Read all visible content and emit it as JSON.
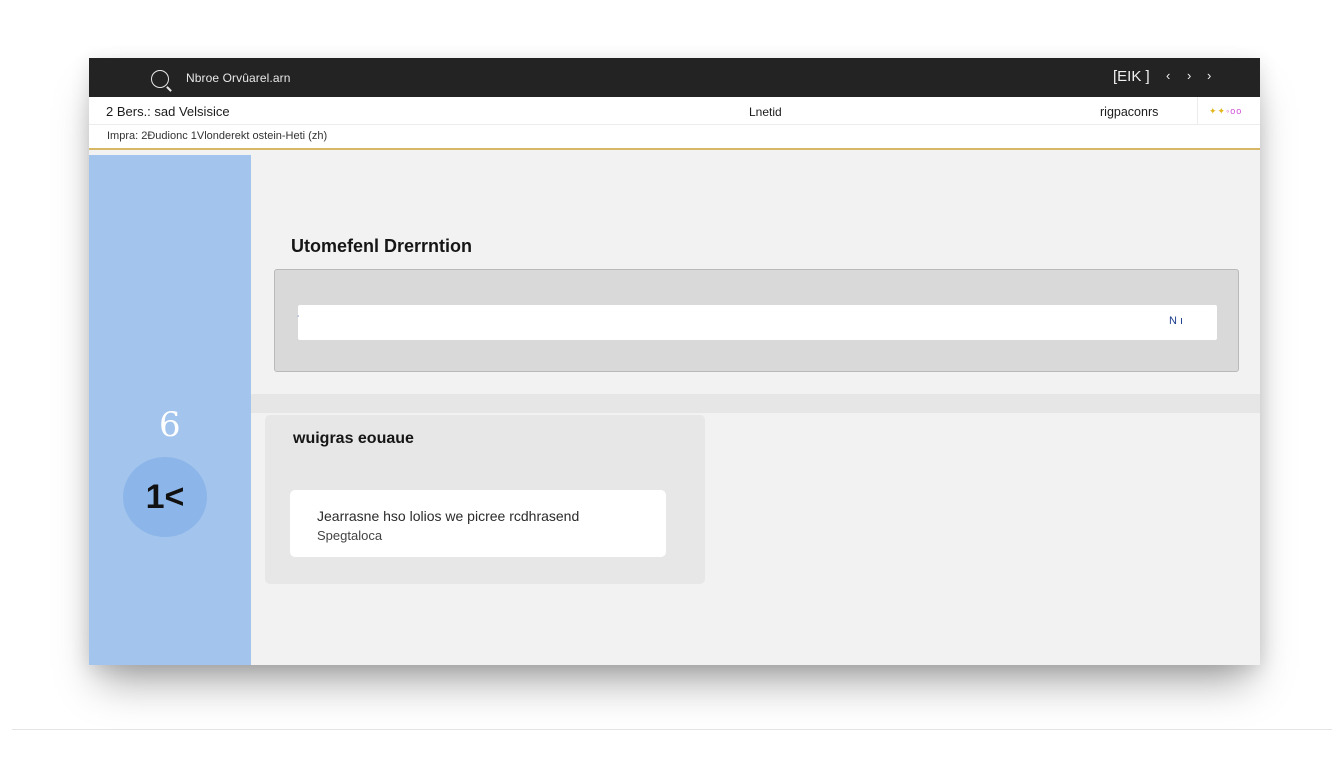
{
  "window": {
    "title": "Nbroe Orvûarel.arn",
    "titlebar_label": "[EIK ]",
    "nav_prev": "‹",
    "nav_next1": "›",
    "nav_next2": "›"
  },
  "infobar": {
    "left_text": "2 Bers.: sad Velsisice",
    "center_text": "Lnetid",
    "right_text": "rigpaconrs",
    "flag_a": "✦✦",
    "flag_b": "◦oo"
  },
  "subbar": {
    "text": "Impra: 2Ðudionc 1Vlonderekt ostein-Heti (zh)"
  },
  "sidebar": {
    "glyph": "6",
    "avatar_text": "1<"
  },
  "main": {
    "section_title": "Utomefenl Drerrntion",
    "input": {
      "caret": "˙",
      "action_label": "N ı"
    },
    "card": {
      "title": "wuigras eouaue",
      "message_line1": "Jearrasne hso lolios we picree rcdhrasend",
      "message_line2": "Spegtaloca"
    }
  },
  "colors": {
    "titlebar": "#232323",
    "sidebar": "#a3c4ec",
    "accent_rule": "#d8b867",
    "panel": "#d9d9d9"
  }
}
